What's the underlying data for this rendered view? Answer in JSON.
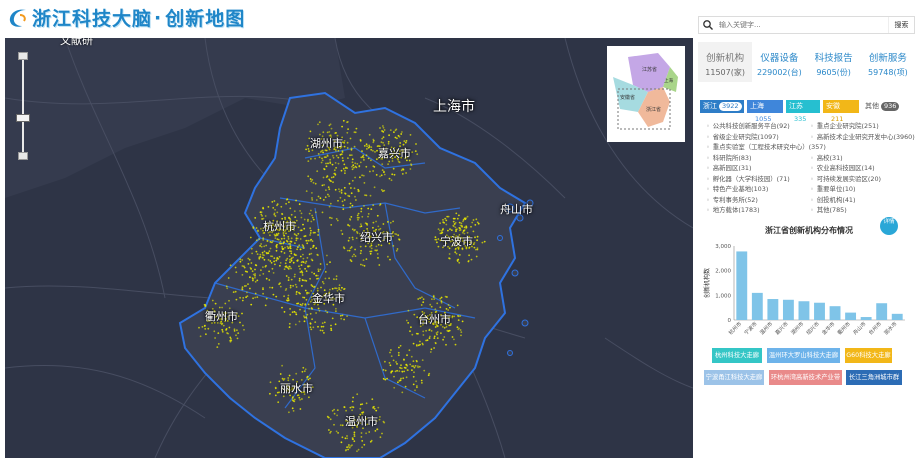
{
  "header": {
    "title_part1": "浙江科技大脑",
    "separator": "·",
    "title_part2": "创新地图"
  },
  "map": {
    "top_cut_label": "文献研",
    "cities": {
      "shanghai": "上海市",
      "huzhou": "湖州市",
      "jiaxing": "嘉兴市",
      "zhoushan": "舟山市",
      "hangzhou": "杭州市",
      "shaoxing": "绍兴市",
      "ningbo": "宁波市",
      "jinhua": "金华市",
      "quzhou": "衢州市",
      "taizhou": "台州市",
      "lishui": "丽水市",
      "wenzhou": "温州市"
    },
    "overview": {
      "regions": [
        "江苏省",
        "安徽省",
        "浙江省",
        "上海"
      ]
    },
    "colors": {
      "background": "#2c3142",
      "boundary": "#2f72e0",
      "dots": "#e6e600"
    }
  },
  "search": {
    "placeholder": "输入关键字...",
    "button": "搜索"
  },
  "stats": [
    {
      "label": "创新机构",
      "value": "11507(家)"
    },
    {
      "label": "仪器设备",
      "value": "229002(台)"
    },
    {
      "label": "科技报告",
      "value": "9605(份)"
    },
    {
      "label": "创新服务",
      "value": "59748(项)"
    }
  ],
  "regions": [
    {
      "name": "浙江",
      "count": "3922"
    },
    {
      "name": "上海",
      "count": "1055"
    },
    {
      "name": "江苏",
      "count": "335"
    },
    {
      "name": "安徽",
      "count": "211"
    },
    {
      "name": "其他",
      "count": "936"
    }
  ],
  "institutions": {
    "left": [
      "公共科技创新服务平台(92)",
      "省级企业研究院(1097)",
      "重点实验室（工程技术研究中心）(357)",
      "科研院所(83)",
      "高新园区(31)",
      "孵化器（大学科技园）(71)",
      "特色产业基地(103)",
      "专利事务所(52)",
      "地方载体(1783)"
    ],
    "right": [
      "重点企业研究院(251)",
      "高新技术企业研究开发中心(3960)",
      "高校(31)",
      "农业高科技园区(14)",
      "可持续发展实验区(20)",
      "重要单位(10)",
      "创投机构(41)",
      "其他(785)"
    ]
  },
  "more_button": "详情",
  "chart_data": {
    "type": "bar",
    "title": "浙江省创新机构分布情况",
    "ylabel": "创新机构数",
    "categories": [
      "杭州市",
      "宁波市",
      "温州市",
      "嘉兴市",
      "湖州市",
      "绍兴市",
      "金华市",
      "衢州市",
      "舟山市",
      "台州市",
      "丽水市"
    ],
    "values": [
      2780,
      1100,
      850,
      820,
      760,
      700,
      560,
      300,
      120,
      680,
      250
    ],
    "ylim": [
      0,
      3000
    ],
    "yticks": [
      "0",
      "1,000",
      "2,000",
      "3,000"
    ],
    "color": "#7fc4e8"
  },
  "buttons": [
    {
      "label": "杭州科技大走廊",
      "color": "#34c6c6"
    },
    {
      "label": "温州环大罗山科技大走廊",
      "color": "#6db3ea"
    },
    {
      "label": "G60科技大走廊",
      "color": "#f2b718"
    },
    {
      "label": "宁波甬江科技大走廊",
      "color": "#9cc3e8"
    },
    {
      "label": "环杭州湾高新技术产业带",
      "color": "#e98a8a"
    },
    {
      "label": "长江三角洲城市群",
      "color": "#2c6cb5"
    }
  ]
}
